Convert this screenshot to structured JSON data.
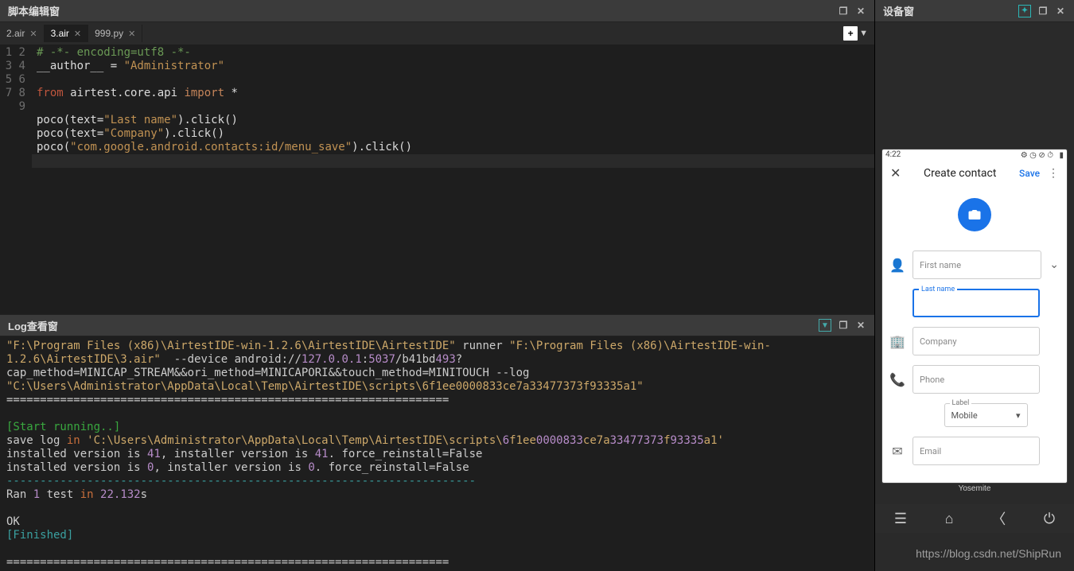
{
  "editor_panel": {
    "title": "脚本编辑窗",
    "tabs": [
      {
        "label": "2.air",
        "active": false
      },
      {
        "label": "3.air",
        "active": true
      },
      {
        "label": "999.py",
        "active": false
      }
    ],
    "code_lines": [
      "# -*- encoding=utf8 -*-",
      "__author__ = \"Administrator\"",
      "",
      "from airtest.core.api import *",
      "",
      "poco(text=\"Last name\").click()",
      "poco(text=\"Company\").click()",
      "poco(\"com.google.android.contacts:id/menu_save\").click()",
      ""
    ]
  },
  "log_panel": {
    "title": "Log查看窗",
    "line1_pre": "\"F:\\Program Files (x86)\\AirtestIDE-win-1.2.6\\AirtestIDE\\AirtestIDE\"",
    "line1_mid": " runner ",
    "line1_post": "\"F:\\Program Files (x86)\\AirtestIDE-win-1.2.6\\AirtestIDE\\3.air\"",
    "line1_tail": "  --device android://",
    "ip": "127.0.0.1",
    "port": "5037",
    "dev_a": "/b41bd",
    "dev_num": "493",
    "dev_tail": "?cap_method=MINICAP_STREAM&&ori_method=MINICAPORI&&touch_method=MINITOUCH --log ",
    "log_path": "\"C:\\Users\\Administrator\\AppData\\Local\\Temp\\AirtestIDE\\scripts\\6f1ee0000833ce7a33477373f93335a1\"",
    "dash1": "==================================================================",
    "start_running": "[Start running..]",
    "save_log_a": "save log ",
    "save_log_kw": "in",
    "save_log_b": " 'C:\\Users\\Administrator\\AppData\\Local\\Temp\\AirtestIDE\\scripts\\",
    "sl_p1": "6",
    "sl_p2": "f1ee",
    "sl_p3": "0000833",
    "sl_p4": "ce7a",
    "sl_p5": "33477373",
    "sl_p6": "f",
    "sl_p7": "93335",
    "sl_p8": "a1'",
    "installed1_a": "installed version is ",
    "installed1_v1": "41",
    "installed1_b": ", installer version is ",
    "installed1_v2": "41",
    "installed1_c": ". force_reinstall=False",
    "installed2_a": "installed version is ",
    "installed2_v1": "0",
    "installed2_b": ", installer version is ",
    "installed2_v2": "0",
    "installed2_c": ". force_reinstall=False",
    "dash2": "----------------------------------------------------------------------",
    "ran_a": "Ran ",
    "ran_n": "1",
    "ran_b": " test ",
    "ran_kw": "in",
    "ran_c": " ",
    "ran_t": "22.132",
    "ran_s": "s",
    "ok": "OK",
    "finished": "[Finished]",
    "dash3": "=================================================================="
  },
  "device_panel": {
    "title": "设备窗",
    "phone": {
      "status_time": "4:22",
      "appbar_title": "Create contact",
      "save_label": "Save",
      "fields": {
        "first_name": "First name",
        "last_name": "Last name",
        "company": "Company",
        "phone": "Phone",
        "label_hint": "Label",
        "mobile": "Mobile",
        "email": "Email"
      }
    },
    "device_name": "Yosemite"
  },
  "watermark": "https://blog.csdn.net/ShipRun"
}
